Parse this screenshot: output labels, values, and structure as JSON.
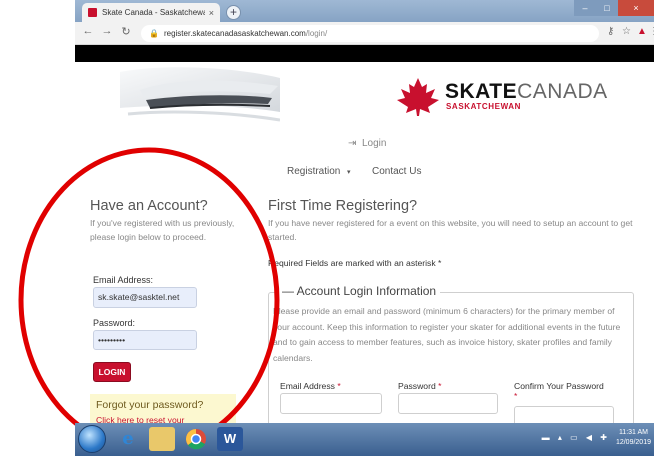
{
  "browser": {
    "tab_title": "Skate Canada - Saskatchewan pa",
    "tab_close": "×",
    "new_tab": "+",
    "url_host": "register.skatecanadasaskatchewan.com",
    "url_path": "/login/",
    "window_buttons": {
      "minimize": "–",
      "maximize": "□",
      "close": "×"
    }
  },
  "site": {
    "logo_bold": "SKATE",
    "logo_thin": "CANADA",
    "logo_sub": "SASKATCHEWAN",
    "login_link": "Login",
    "menu": {
      "registration": "Registration",
      "contact": "Contact Us"
    }
  },
  "login": {
    "heading": "Have an Account?",
    "intro": "If you've registered with us previously, please login below to proceed.",
    "email_label": "Email Address:",
    "email_value": "sk.skate@sasktel.net",
    "password_label": "Password:",
    "password_value": "•••••••••",
    "login_button": "LOGIN",
    "forgot_title": "Forgot your password?",
    "forgot_link": "Click here to reset your"
  },
  "register": {
    "heading": "First Time Registering?",
    "intro": "If you have never registered for a event on this website, you will need to setup an account to get started.",
    "required_note": "Required Fields are marked with an asterisk *",
    "legend": "Account Login Information",
    "description": "Please provide an email and password (minimum 6 characters) for the primary member of your account. Keep this information to register your skater for additional events in the future and to gain access to member features, such as invoice history, skater profiles and family calendars.",
    "fields": {
      "email": "Email Address",
      "password": "Password",
      "confirm": "Confirm Your Password",
      "asterisk": "*"
    }
  },
  "taskbar": {
    "time": "11:31 AM",
    "date": "12/09/2019"
  },
  "colors": {
    "brand_red": "#c8102e",
    "annotation_red": "#e00000",
    "input_fill": "#e8eefb"
  }
}
